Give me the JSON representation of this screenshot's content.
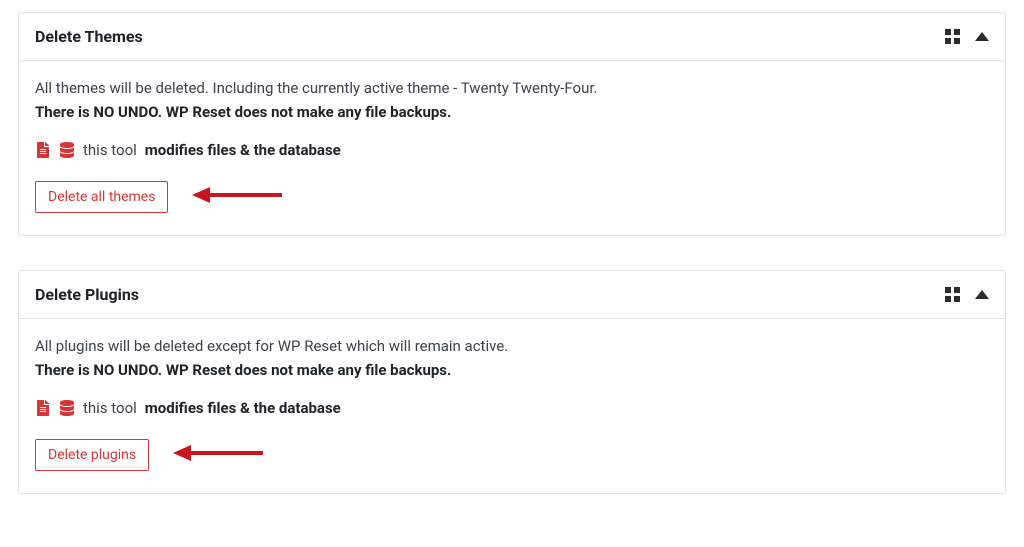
{
  "cards": [
    {
      "title": "Delete Themes",
      "description": "All themes will be deleted. Including the currently active theme - Twenty Twenty-Four.",
      "warning": "There is NO UNDO. WP Reset does not make any file backups.",
      "tool_prefix": "this tool",
      "tool_emph": "modifies files & the database",
      "button_label": "Delete all themes"
    },
    {
      "title": "Delete Plugins",
      "description": "All plugins will be deleted except for WP Reset which will remain active.",
      "warning": "There is NO UNDO. WP Reset does not make any file backups.",
      "tool_prefix": "this tool",
      "tool_emph": "modifies files & the database",
      "button_label": "Delete plugins"
    }
  ]
}
